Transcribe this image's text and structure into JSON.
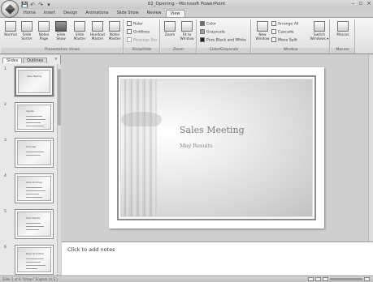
{
  "window": {
    "title": "02_Opening - Microsoft PowerPoint",
    "minimize": "–",
    "maximize": "▫",
    "close": "×"
  },
  "quick_access": [
    "💾",
    "↶",
    "↷",
    "▾"
  ],
  "tabs": [
    {
      "label": "Home",
      "active": false
    },
    {
      "label": "Insert",
      "active": false
    },
    {
      "label": "Design",
      "active": false
    },
    {
      "label": "Animations",
      "active": false
    },
    {
      "label": "Slide Show",
      "active": false
    },
    {
      "label": "Review",
      "active": false
    },
    {
      "label": "View",
      "active": true
    }
  ],
  "ribbon": {
    "presentation_views": {
      "label": "Presentation Views",
      "buttons": [
        "Normal",
        "Slide Sorter",
        "Notes Page",
        "Slide Show",
        "Slide Master",
        "Handout Master",
        "Notes Master"
      ]
    },
    "show_hide": {
      "label": "Show/Hide",
      "items": [
        "Ruler",
        "Gridlines",
        "Message Bar"
      ]
    },
    "zoom": {
      "label": "Zoom",
      "buttons": [
        "Zoom",
        "Fit to Window"
      ]
    },
    "color_grayscale": {
      "label": "Color/Grayscale",
      "items": [
        "Color",
        "Grayscale",
        "Pure Black and White"
      ]
    },
    "window": {
      "label": "Window",
      "new_window": "New Window",
      "items": [
        "Arrange All",
        "Cascade",
        "Move Split"
      ],
      "switch_windows": "Switch Windows ▾"
    },
    "macros": {
      "label": "Macros",
      "button": "Macros"
    }
  },
  "left_pane": {
    "tabs": [
      "Slides",
      "Outlines"
    ],
    "close": "×",
    "slides": [
      {
        "num": "1",
        "title": "Sales Meeting"
      },
      {
        "num": "2",
        "title": "Agenda"
      },
      {
        "num": "3",
        "title": "Overview"
      },
      {
        "num": "4",
        "title": "Sales Summary"
      },
      {
        "num": "5",
        "title": "Team Results"
      },
      {
        "num": "6",
        "title": "Regional Outlook"
      }
    ]
  },
  "slide": {
    "title": "Sales Meeting",
    "subtitle": "May Results"
  },
  "notes": {
    "placeholder": "Click to add notes"
  },
  "status": {
    "text": "Slide 1 of 6   \"Urban\"   English (U.S.)"
  }
}
